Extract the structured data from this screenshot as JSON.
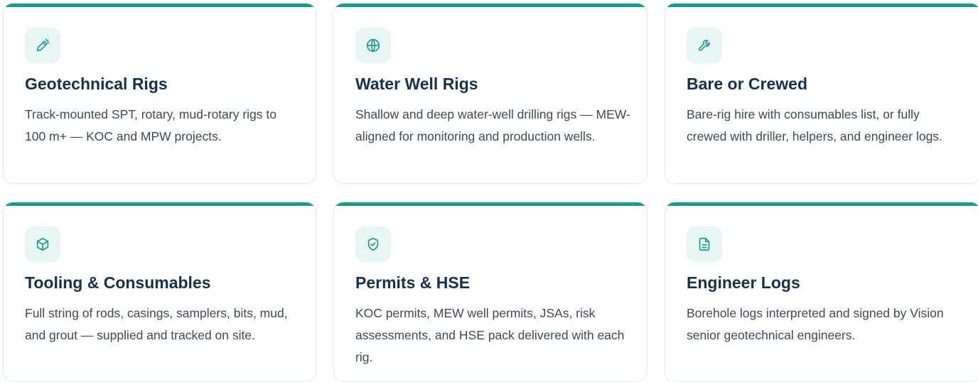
{
  "cards": [
    {
      "icon": "pen-drill-icon",
      "title": "Geotechnical Rigs",
      "description": "Track-mounted SPT, rotary, mud-rotary rigs to 100 m+ — KOC and MPW projects."
    },
    {
      "icon": "globe-icon",
      "title": "Water Well Rigs",
      "description": "Shallow and deep water-well drilling rigs — MEW-aligned for monitoring and production wells."
    },
    {
      "icon": "wrench-icon",
      "title": "Bare or Crewed",
      "description": "Bare-rig hire with consumables list, or fully crewed with driller, helpers, and engineer logs."
    },
    {
      "icon": "box-icon",
      "title": "Tooling & Consumables",
      "description": "Full string of rods, casings, samplers, bits, mud, and grout — supplied and tracked on site."
    },
    {
      "icon": "shield-check-icon",
      "title": "Permits & HSE",
      "description": "KOC permits, MEW well permits, JSAs, risk assessments, and HSE pack delivered with each rig."
    },
    {
      "icon": "document-icon",
      "title": "Engineer Logs",
      "description": "Borehole logs interpreted and signed by Vision senior geotechnical engineers."
    }
  ],
  "colors": {
    "accent": "#1a9c8a",
    "icon_bg": "#e7f5f3",
    "title": "#16304f",
    "body_text": "#3f4a57",
    "border": "#e2e8ee"
  }
}
